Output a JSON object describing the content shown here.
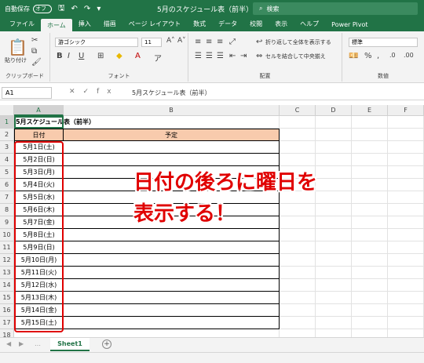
{
  "titlebar": {
    "autosave_label": "自動保存",
    "autosave_state": "オフ",
    "doc_title": "5月のスケジュール表（前半）.xlsx  ▾",
    "search_placeholder": "検索"
  },
  "ribbon_tabs": [
    "ファイル",
    "ホーム",
    "挿入",
    "描画",
    "ページ レイアウト",
    "数式",
    "データ",
    "校閲",
    "表示",
    "ヘルプ",
    "Power Pivot"
  ],
  "ribbon": {
    "paste_label": "貼り付け",
    "clipboard_label": "クリップボード",
    "font_name": "游ゴシック",
    "font_size": "11",
    "font_label": "フォント",
    "wrap_text": "折り返して全体を表示する",
    "merge_center": "セルを結合して中央揃え",
    "alignment_label": "配置",
    "number_format": "標準",
    "number_label": "数値"
  },
  "formula_bar": {
    "name_box": "A1",
    "fx": "fx",
    "content": "5月スケジュール表（前半）"
  },
  "sheet": {
    "columns": [
      "A",
      "B",
      "C",
      "D",
      "E",
      "F"
    ],
    "rows": [
      "1",
      "2",
      "3",
      "4",
      "5",
      "6",
      "7",
      "8",
      "9",
      "10",
      "11",
      "12",
      "13",
      "14",
      "15",
      "16",
      "17",
      "18"
    ],
    "title": "5月スケジュール表（前半）",
    "header_date": "日付",
    "header_plan": "予定",
    "dates": [
      "5月1日(土)",
      "5月2日(日)",
      "5月3日(月)",
      "5月4日(火)",
      "5月5日(水)",
      "5月6日(木)",
      "5月7日(金)",
      "5月8日(土)",
      "5月9日(日)",
      "5月10日(月)",
      "5月11日(火)",
      "5月12日(水)",
      "5月13日(木)",
      "5月14日(金)",
      "5月15日(土)"
    ]
  },
  "callout": {
    "line1": "日付の後ろに曜日を",
    "line2": "表示する！"
  },
  "sheet_tabs": {
    "active": "Sheet1"
  },
  "colors": {
    "excel_green": "#217346",
    "header_fill": "#f8cbad",
    "annotation_red": "#e00000"
  }
}
